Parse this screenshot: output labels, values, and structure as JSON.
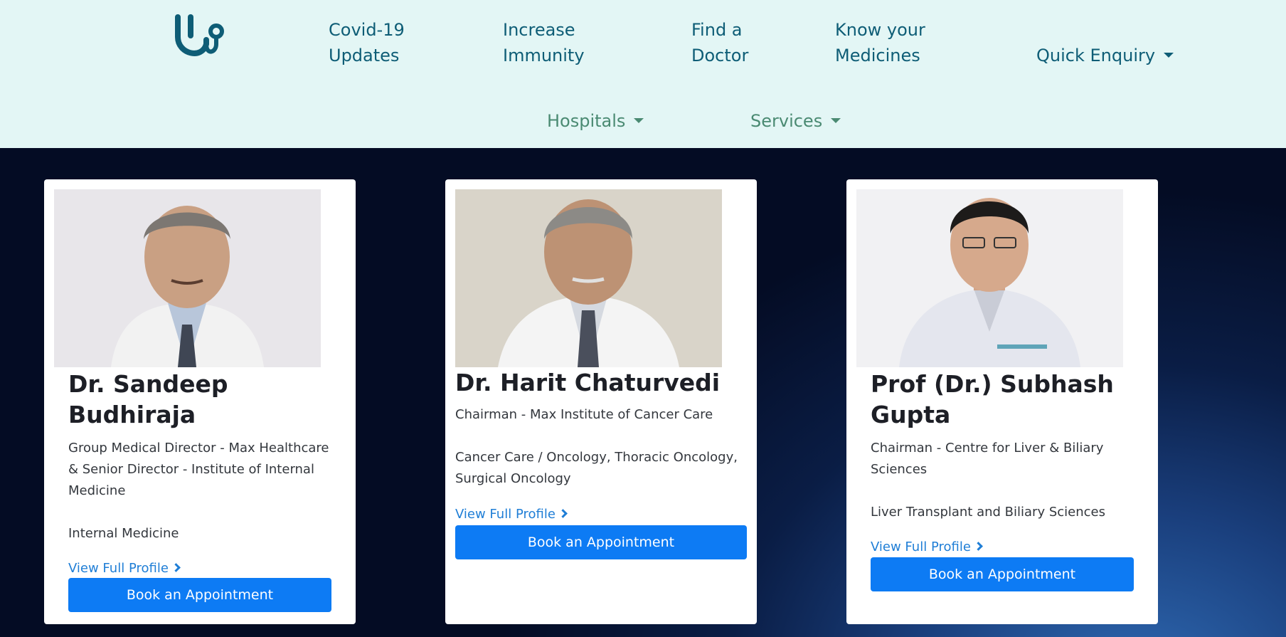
{
  "nav": {
    "logo_icon": "stethoscope-icon",
    "links": [
      {
        "label": "Covid-19\nUpdates"
      },
      {
        "label": "Increase\nImmunity"
      },
      {
        "label": "Find a\nDoctor"
      },
      {
        "label": "Know your\nMedicines"
      },
      {
        "label": "Quick Enquiry"
      }
    ],
    "dropdowns": [
      {
        "label": "Hospitals"
      },
      {
        "label": "Services"
      }
    ]
  },
  "doctors": [
    {
      "name": "Dr. Sandeep\nBudhiraja",
      "title": "Group Medical Director - Max Healthcare & Senior Director - Institute of Internal Medicine",
      "specialty": "Internal Medicine",
      "profile_label": "View Full Profile",
      "book_label": "Book an Appointment"
    },
    {
      "name": "Dr. Harit Chaturvedi",
      "title": "Chairman - Max Institute of Cancer Care",
      "specialty": "Cancer Care / Oncology, Thoracic Oncology, Surgical Oncology",
      "profile_label": "View Full Profile",
      "book_label": "Book an Appointment"
    },
    {
      "name": "Prof (Dr.) Subhash\nGupta",
      "title": "Chairman - Centre for Liver & Biliary Sciences",
      "specialty": "Liver Transplant and Biliary Sciences",
      "profile_label": "View Full Profile",
      "book_label": "Book an Appointment"
    }
  ],
  "colors": {
    "nav_bg": "#e3f6f5",
    "nav_link": "#0e5d76",
    "nav_dropdown": "#4a8a72",
    "button": "#0d7bf4",
    "link": "#1f7ed6"
  }
}
